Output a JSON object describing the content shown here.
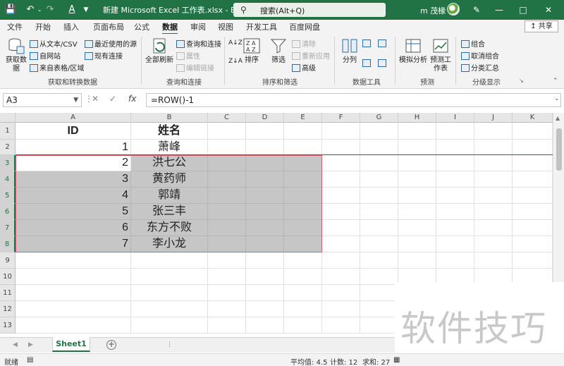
{
  "titlebar": {
    "title": "新建 Microsoft Excel 工作表.xlsx  -  Excel",
    "search_label": "搜索(Alt+Q)",
    "user": "m 茂椽",
    "icons": {
      "autosave": "save-icon",
      "undo": "undo-icon",
      "redo": "redo-icon",
      "font_color": "font-color-icon",
      "customize": "customize-icon",
      "search": "search-icon",
      "pen": "pen-icon"
    }
  },
  "tabs": [
    "文件",
    "开始",
    "插入",
    "页面布局",
    "公式",
    "数据",
    "审阅",
    "视图",
    "开发工具",
    "百度网盘"
  ],
  "active_tab": "数据",
  "share_label": "共享",
  "ribbon": {
    "get_data": "获取数据",
    "from_text": "从文本/CSV",
    "from_web": "自网站",
    "from_table": "来自表格/区域",
    "recent": "最近使用的源",
    "existing": "现有连接",
    "group_get": "获取和转换数据",
    "refresh_all": "全部刷新",
    "queries": "查询和连接",
    "properties": "属性",
    "edit_links": "编辑链接",
    "group_queries": "查询和连接",
    "sort": "排序",
    "filter": "筛选",
    "clear": "清除",
    "reapply": "重新应用",
    "advanced": "高级",
    "group_sort": "排序和筛选",
    "split": "分列",
    "group_tools": "数据工具",
    "whatif": "模拟分析",
    "forecast": "预测工作表",
    "group_forecast": "预测",
    "group_btn": "组合",
    "ungroup": "取消组合",
    "subtotal": "分类汇总",
    "group_outline": "分级显示"
  },
  "formula": {
    "name_box": "A3",
    "fx": "fx",
    "value": "=ROW()-1"
  },
  "columns": [
    "A",
    "B",
    "C",
    "D",
    "E",
    "F",
    "G",
    "H",
    "I",
    "J",
    "K"
  ],
  "rows": [
    "1",
    "2",
    "3",
    "4",
    "5",
    "6",
    "7",
    "8",
    "9",
    "10",
    "11",
    "12",
    "13"
  ],
  "table": {
    "header": {
      "id": "ID",
      "name": "姓名"
    },
    "data": [
      {
        "id": "1",
        "name": "萧峰"
      },
      {
        "id": "2",
        "name": "洪七公"
      },
      {
        "id": "3",
        "name": "黄药师"
      },
      {
        "id": "4",
        "name": "郭靖"
      },
      {
        "id": "5",
        "name": "张三丰"
      },
      {
        "id": "6",
        "name": "东方不败"
      },
      {
        "id": "7",
        "name": "李小龙"
      }
    ]
  },
  "sheet": {
    "name": "Sheet1"
  },
  "watermark": "软件技巧",
  "status": {
    "mode": "就绪",
    "average": "平均值: 4.5",
    "count": "计数: 12",
    "sum": "求和: 27"
  }
}
